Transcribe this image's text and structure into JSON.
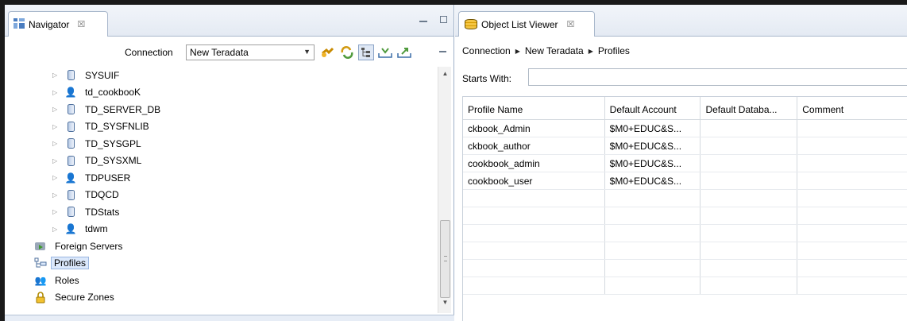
{
  "navigator": {
    "tab_label": "Navigator",
    "close_glyph": "☒",
    "connection_label": "Connection",
    "connection_value": "New Teradata",
    "toolbar_icons": [
      "connect-icon",
      "refresh-icon",
      "tree-layout-icon",
      "import-icon",
      "export-icon"
    ],
    "tree_items": [
      {
        "label": "SYSUIF",
        "type": "database",
        "expandable": true
      },
      {
        "label": "td_cookbooK",
        "type": "user",
        "expandable": true
      },
      {
        "label": "TD_SERVER_DB",
        "type": "database",
        "expandable": true
      },
      {
        "label": "TD_SYSFNLIB",
        "type": "database",
        "expandable": true
      },
      {
        "label": "TD_SYSGPL",
        "type": "database",
        "expandable": true
      },
      {
        "label": "TD_SYSXML",
        "type": "database",
        "expandable": true
      },
      {
        "label": "TDPUSER",
        "type": "user",
        "expandable": true
      },
      {
        "label": "TDQCD",
        "type": "database",
        "expandable": true
      },
      {
        "label": "TDStats",
        "type": "database",
        "expandable": true
      },
      {
        "label": "tdwm",
        "type": "user",
        "expandable": true
      }
    ],
    "top_items": [
      {
        "label": "Foreign Servers",
        "icon": "foreign-servers-icon",
        "selected": false
      },
      {
        "label": "Profiles",
        "icon": "profiles-icon",
        "selected": true
      },
      {
        "label": "Roles",
        "icon": "roles-icon",
        "selected": false
      },
      {
        "label": "Secure Zones",
        "icon": "lock-icon",
        "selected": false
      }
    ]
  },
  "object_list_viewer": {
    "tab_label": "Object List Viewer",
    "close_glyph": "☒",
    "breadcrumb": [
      "Connection",
      "New Teradata",
      "Profiles"
    ],
    "starts_with_label": "Starts With:",
    "starts_with_value": "",
    "columns": [
      "Profile Name",
      "Default Account",
      "Default Databa...",
      "Comment"
    ],
    "rows": [
      [
        "ckbook_Admin",
        "$M0+EDUC&S...",
        "",
        ""
      ],
      [
        "ckbook_author",
        "$M0+EDUC&S...",
        "",
        ""
      ],
      [
        "cookbook_admin",
        "$M0+EDUC&S...",
        "",
        ""
      ],
      [
        "cookbook_user",
        "$M0+EDUC&S...",
        "",
        ""
      ]
    ],
    "empty_rows": 6
  }
}
